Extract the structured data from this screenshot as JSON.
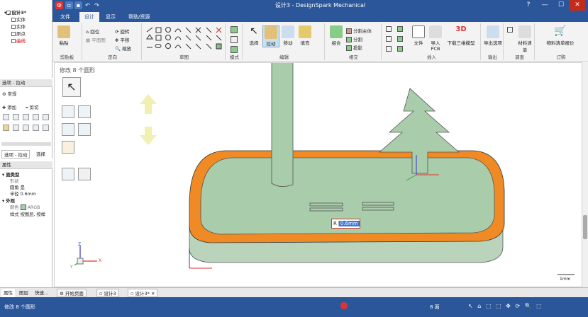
{
  "window": {
    "title": "设计3 - DesignSpark Mechanical",
    "help_label": "?",
    "minimize_label": "—",
    "maximize_label": "☐",
    "close_label": "✕"
  },
  "menu": {
    "tabs": [
      "文件",
      "设计",
      "显示",
      "帮助/资源"
    ],
    "active_tab": "设计"
  },
  "ribbon": {
    "clipboard": {
      "paste": "粘贴",
      "group": "剪贴板"
    },
    "orient": {
      "home": "回位",
      "plane_view": "平面图",
      "rotate": "旋转",
      "pan": "平移",
      "zoom": "缩放",
      "group": "定向"
    },
    "sketch": {
      "group": "草图"
    },
    "mode": {
      "group": "模式"
    },
    "edit": {
      "select": "选择",
      "pull": "拉动",
      "move": "移动",
      "fill": "填充",
      "group": "编辑"
    },
    "intersect": {
      "combine": "组合",
      "split_body": "分割主体",
      "split": "分割",
      "project": "投影",
      "group": "相交"
    },
    "insert": {
      "file": "文件",
      "import_pcb": "导入PCB",
      "download_3d": "下载三维模型",
      "model_3d": "3D",
      "group": "插入"
    },
    "output": {
      "export": "导出选项",
      "group": "输出"
    },
    "bom": {
      "materials": "材料清单",
      "group": "调查"
    },
    "order": {
      "quote": "物料清单报价",
      "group": "订购"
    }
  },
  "tree": {
    "root": "设计3*",
    "items": [
      "实体",
      "实体",
      "原点",
      "曲线"
    ]
  },
  "options": {
    "title": "选项 - 拉动",
    "section": "常规",
    "add": "添加",
    "cut": "剪切",
    "tab_options": "选项 - 拉动",
    "tab_select": "选择"
  },
  "properties": {
    "title": "属性",
    "face_type_label": "面类型",
    "shape_label": "形状",
    "fillet_label": "圆角",
    "fillet_value": "是",
    "radius_label": "半径",
    "radius_value": "0.6mm",
    "appearance_label": "外观",
    "color_label": "颜色",
    "color_value": "ARGB",
    "style_label": "样式",
    "style_value": "按图层, 按样"
  },
  "viewport": {
    "hint": "修改 8 个圆形",
    "dim_prefix": "R",
    "dim_value": "0.6mm",
    "scale_label": "1mm",
    "axis_x": "X",
    "axis_y": "Y",
    "axis_z": "Z"
  },
  "bottom_tabs": {
    "props": "属性",
    "layers": "图层",
    "quick": "快速...",
    "start": "开始页面",
    "design3": "设计3",
    "design3_active": "设计3*"
  },
  "status": {
    "message": "修改 8 个圆形",
    "face_count": "8 面"
  },
  "colors": {
    "accent": "#2b579a",
    "model_green": "#a9ccaa",
    "fillet_orange": "#f08a24",
    "dim_red": "#d9302c"
  }
}
